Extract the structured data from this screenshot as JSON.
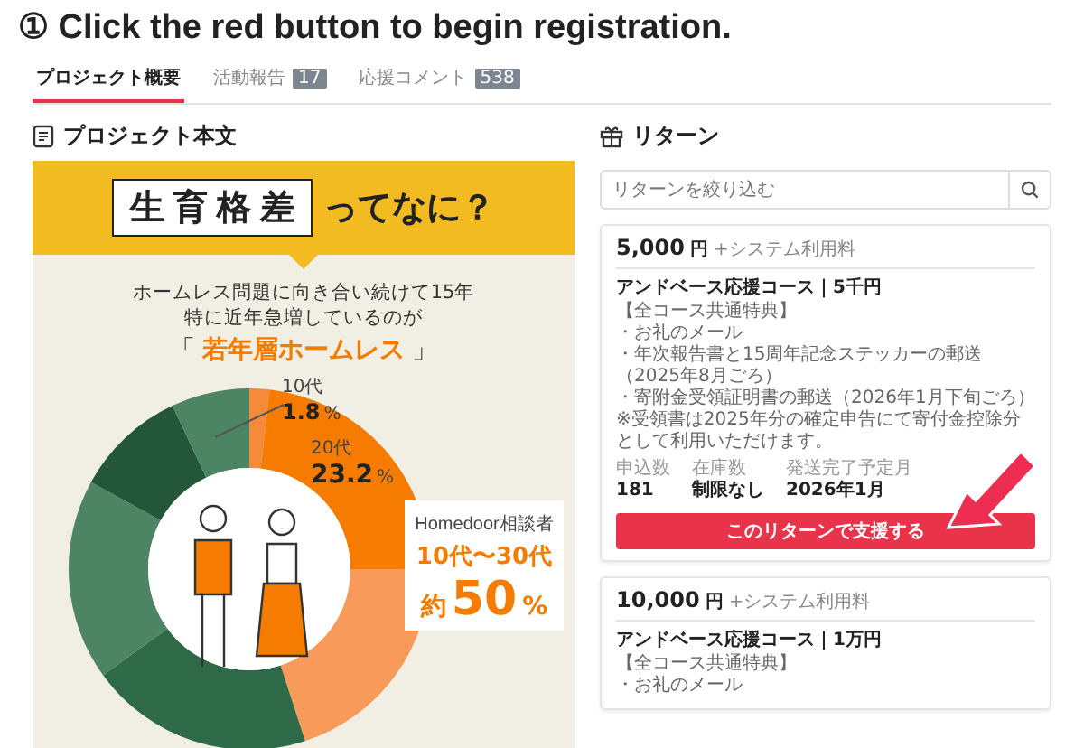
{
  "instruction": {
    "text": "① Click the red button to begin registration."
  },
  "tabs": [
    {
      "label": "プロジェクト概要",
      "selected": true
    },
    {
      "label": "活動報告",
      "count": "17",
      "selected": false
    },
    {
      "label": "応援コメント",
      "count": "538",
      "selected": false
    }
  ],
  "project": {
    "heading": "プロジェクト本文",
    "infographic": {
      "title_boxed": "生育格差",
      "title_rest": "ってなに？",
      "lines": [
        "ホームレス問題に向き合い続けて15年",
        "特に近年急増しているのが"
      ],
      "highlight": {
        "open": "「",
        "text": "若年層ホームレス",
        "close": "」"
      },
      "donut_labels": [
        {
          "age": "10代",
          "percent": "1.8",
          "unit": "%"
        },
        {
          "age": "20代",
          "percent": "23.2",
          "unit": "%"
        }
      ],
      "callout": {
        "caption": "Homedoor相談者",
        "range": "10代〜30代",
        "prefix": "約",
        "value": "50",
        "unit": "%"
      }
    }
  },
  "returns": {
    "heading": "リターン",
    "search": {
      "placeholder": "リターンを絞り込む"
    },
    "cards": [
      {
        "price": "5,000",
        "currency": "円",
        "fee": "+システム利用料",
        "title": "アンドベース応援コース｜5千円",
        "lines": [
          "【全コース共通特典】",
          "・お礼のメール",
          "・年次報告書と15周年記念ステッカーの郵送（2025年8月ごろ）",
          "・寄附金受領証明書の郵送（2026年1月下旬ごろ）",
          "※受領書は2025年分の確定申告にて寄付金控除分として利用いただけます。"
        ],
        "stats": [
          {
            "label": "申込数",
            "value": "181"
          },
          {
            "label": "在庫数",
            "value": "制限なし"
          },
          {
            "label": "発送完了予定月",
            "value": "2026年1月"
          }
        ],
        "button": "このリターンで支援する",
        "pointer": true
      },
      {
        "price": "10,000",
        "currency": "円",
        "fee": "+システム利用料",
        "title": "アンドベース応援コース｜1万円",
        "lines": [
          "【全コース共通特典】",
          "・お礼のメール"
        ],
        "pointer": false
      }
    ]
  }
}
